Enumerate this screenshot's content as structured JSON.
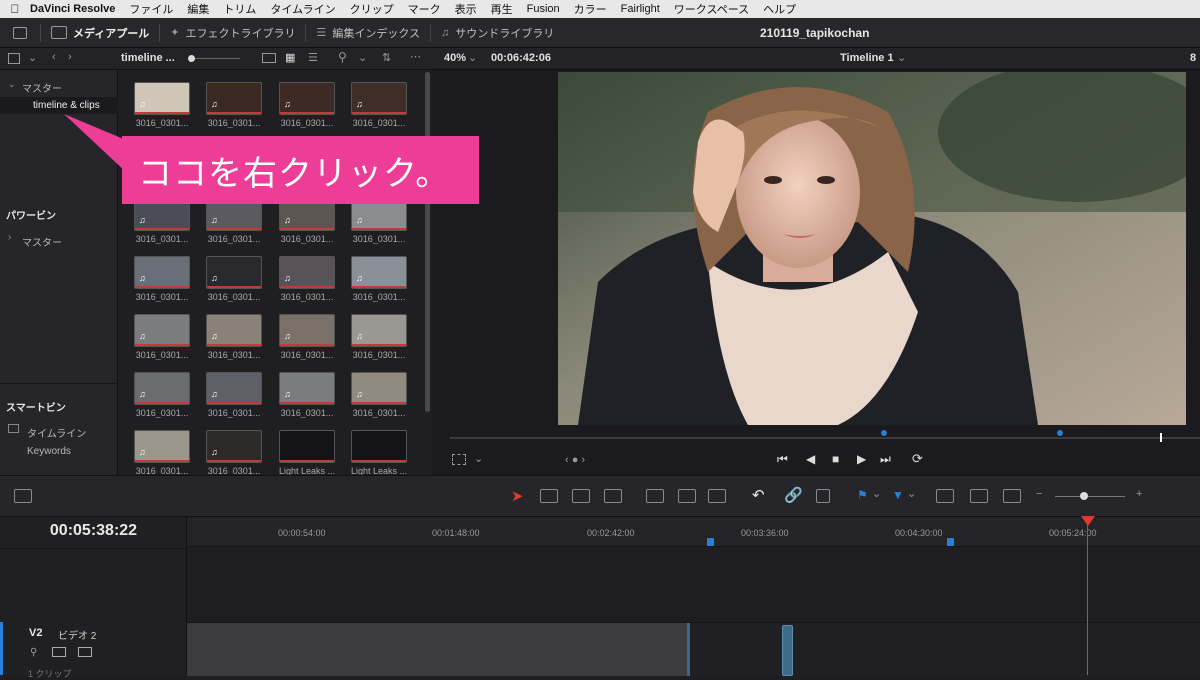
{
  "menubar": {
    "app": "DaVinci Resolve",
    "items": [
      "ファイル",
      "編集",
      "トリム",
      "タイムライン",
      "クリップ",
      "マーク",
      "表示",
      "再生",
      "Fusion",
      "カラー",
      "Fairlight",
      "ワークスペース",
      "ヘルプ"
    ]
  },
  "pagebar": {
    "tabs": [
      "メディアプール",
      "エフェクトライブラリ",
      "編集インデックス",
      "サウンドライブラリ"
    ],
    "project_title": "210119_tapikochan"
  },
  "toolbar2": {
    "bin_name": "timeline ...",
    "zoom": "40%",
    "viewer_timecode": "00:06:42:06",
    "timeline_name": "Timeline 1",
    "right_trunc": "8"
  },
  "bins": {
    "master_label": "マスター",
    "selected_bin": "timeline & clips",
    "power_bins_header": "パワービン",
    "power_master": "マスター",
    "smart_bins_header": "スマートビン",
    "smart_timeline": "タイムライン",
    "smart_keywords": "Keywords"
  },
  "clips": {
    "rows": [
      [
        "3016_0301...",
        "3016_0301...",
        "3016_0301...",
        "3016_0301..."
      ],
      [
        "3016_0301...",
        "3016_0301...",
        "3016_0301...",
        "3016_0301..."
      ],
      [
        "3016_0301...",
        "3016_0301...",
        "3016_0301...",
        "3016_0301..."
      ],
      [
        "3016_0301...",
        "3016_0301...",
        "3016_0301...",
        "3016_0301..."
      ],
      [
        "3016_0301...",
        "3016_0301...",
        "3016_0301...",
        "3016_0301..."
      ],
      [
        "3016_0301...",
        "3016_0301...",
        "Light Leaks ...",
        "Light Leaks ..."
      ]
    ],
    "thumb_colors": [
      [
        "#cfc6b8",
        "#3a2a22",
        "#3d2a24",
        "#3f2e28"
      ],
      [
        "#4a4d55",
        "#5a5a60",
        "#5d5650",
        "#8a8c90"
      ],
      [
        "#6a6e78",
        "#2a2a2e",
        "#5a5258",
        "#8a9098"
      ],
      [
        "#7a7c80",
        "#8a8278",
        "#7a7068",
        "#9a9890"
      ],
      [
        "#6a6c70",
        "#5e6268",
        "#7a7c80",
        "#908a80"
      ],
      [
        "#9a968c",
        "#2e2a2a",
        "#141416",
        "#141416"
      ]
    ]
  },
  "timeline": {
    "timecode": "00:05:38:22",
    "ruler": [
      "00:00:54:00",
      "00:01:48:00",
      "00:02:42:00",
      "00:03:36:00",
      "00:04:30:00",
      "00:05:24:00"
    ],
    "track_id": "V2",
    "track_name": "ビデオ 2",
    "track_sub": "1 クリップ"
  },
  "callout": {
    "text": "ココを右クリック。",
    "color": "#ee3d96"
  },
  "colors": {
    "accent_blue": "#2a7fd9",
    "playhead": "#e03a2e"
  }
}
